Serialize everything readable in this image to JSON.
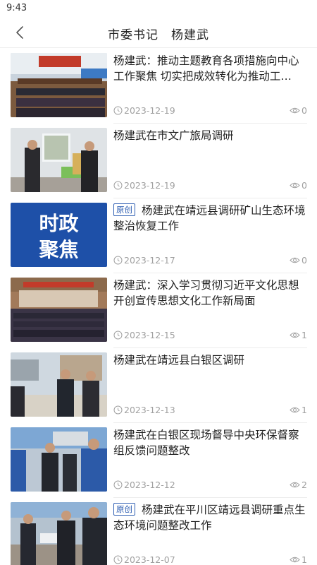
{
  "status_bar": {
    "time": "9:43"
  },
  "header": {
    "title": "市委书记　杨建武"
  },
  "articles": [
    {
      "title": "杨建武：推动主题教育各项措施向中心工作聚焦 切实把成效转化为推动工…",
      "badge": "",
      "date": "2023-12-19",
      "views": "0",
      "thumbnail": "meeting-hall-photo"
    },
    {
      "title": "杨建武在市文广旅局调研",
      "badge": "",
      "date": "2023-12-19",
      "views": "0",
      "thumbnail": "office-visit-photo"
    },
    {
      "title": "杨建武在靖远县调研矿山生态环境整治恢复工作",
      "badge": "原创",
      "date": "2023-12-17",
      "views": "0",
      "thumbnail": "political-focus-graphic",
      "thumb_text": [
        "时政",
        "聚焦"
      ]
    },
    {
      "title": "杨建武：深入学习贯彻习近平文化思想 开创宣传思想文化工作新局面",
      "badge": "",
      "date": "2023-12-15",
      "views": "1",
      "thumbnail": "auditorium-meeting-photo"
    },
    {
      "title": "杨建武在靖远县白银区调研",
      "badge": "",
      "date": "2023-12-13",
      "views": "1",
      "thumbnail": "outdoor-site-visit-photo"
    },
    {
      "title": "杨建武在白银区现场督导中央环保督察组反馈问题整改",
      "badge": "",
      "date": "2023-12-12",
      "views": "2",
      "thumbnail": "factory-inspection-photo"
    },
    {
      "title": "杨建武在平川区靖远县调研重点生态环境问题整改工作",
      "badge": "原创",
      "date": "2023-12-07",
      "views": "1",
      "thumbnail": "field-inspection-photo"
    }
  ],
  "colors": {
    "badge": "#2f5fb3",
    "meta_text": "#a0a0a0",
    "focus_graphic_bg": "#1e50a8"
  }
}
